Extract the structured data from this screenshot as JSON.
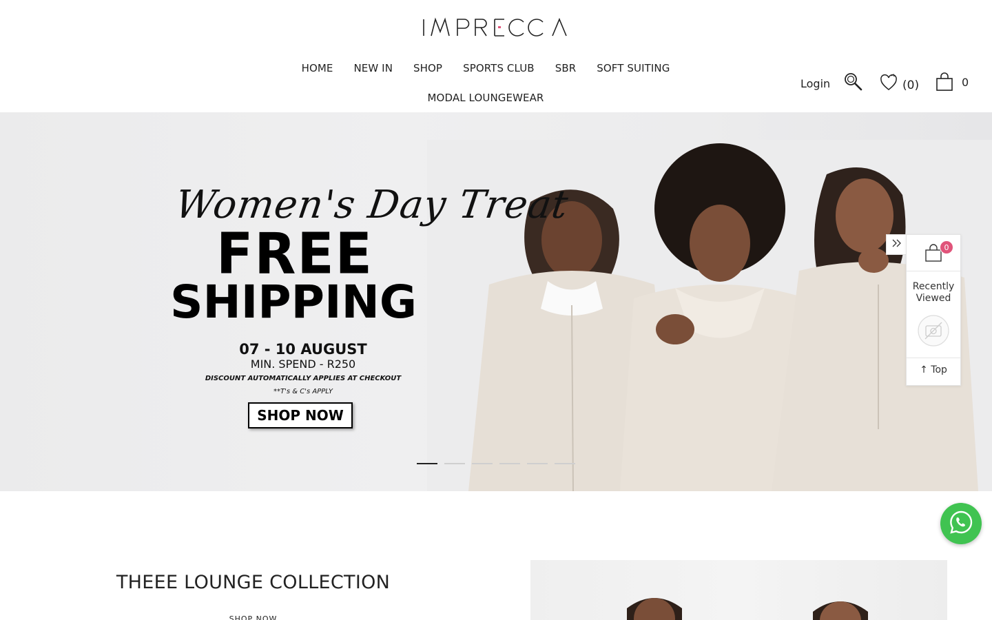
{
  "brand": {
    "name": "IMPRECCA"
  },
  "nav": {
    "items": [
      "HOME",
      "NEW IN",
      "SHOP",
      "SPORTS CLUB",
      "SBR",
      "SOFT SUITING"
    ],
    "second_row": [
      "MODAL LOUNGEWEAR"
    ]
  },
  "tools": {
    "login": "Login",
    "search_icon": "search-icon",
    "wishlist_icon": "heart-icon",
    "wishlist_count": "(0)",
    "cart_icon": "bag-icon",
    "cart_count": "0"
  },
  "hero": {
    "script_title": "Women's Day Treat",
    "headline_1": "FREE",
    "headline_2": "SHIPPING",
    "dates": "07 - 10 AUGUST",
    "min_spend": "MIN. SPEND - R250",
    "discount_note": "DISCOUNT AUTOMATICALLY APPLIES AT CHECKOUT",
    "terms": "**T's & C's APPLY",
    "cta": "SHOP NOW",
    "slide_count": 6,
    "active_slide": 1
  },
  "side_panel": {
    "cart_badge": "0",
    "recently_viewed_1": "Recently",
    "recently_viewed_2": "Viewed",
    "top_label": "Top"
  },
  "whatsapp": {
    "icon": "whatsapp-icon"
  },
  "collection": {
    "title": "THEEE LOUNGE COLLECTION",
    "link": "SHOP NOW"
  },
  "colors": {
    "badge": "#e0547a",
    "whatsapp": "#40c351",
    "logo_accent": "#e0547a"
  }
}
